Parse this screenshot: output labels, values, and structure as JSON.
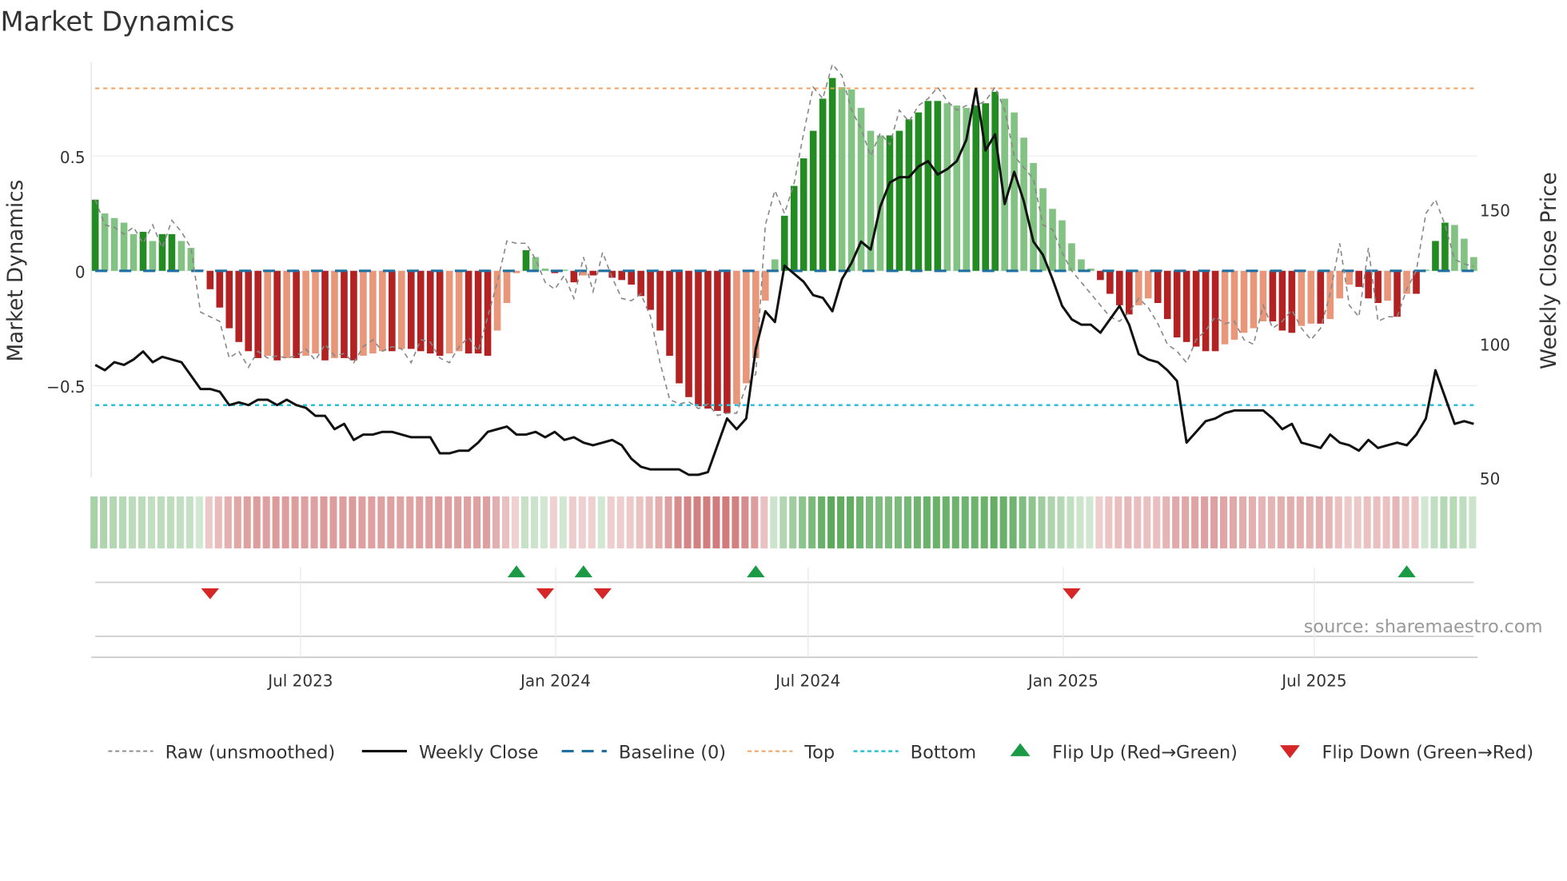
{
  "chart_data": {
    "type": "bar",
    "title": "Market Dynamics",
    "ylabel": "Market Dynamics",
    "ylabel_right": "Weekly Close Price",
    "ylim": [
      -0.9,
      0.91
    ],
    "ylim_right": [
      50,
      205
    ],
    "yticks": [
      {
        "value": 0.5,
        "label": "0.5"
      },
      {
        "value": 0,
        "label": "0"
      },
      {
        "value": -0.5,
        "label": "−0.5"
      }
    ],
    "yticks_right": [
      {
        "value": 150,
        "label": "150"
      },
      {
        "value": 100,
        "label": "100"
      },
      {
        "value": 50,
        "label": "50"
      }
    ],
    "x_start": "2023-02-03",
    "x_end": "2025-10-24",
    "xticks": [
      {
        "date": "2023-07-01",
        "label": "Jul 2023"
      },
      {
        "date": "2024-01-01",
        "label": "Jan 2024"
      },
      {
        "date": "2024-07-01",
        "label": "Jul 2024"
      },
      {
        "date": "2025-01-01",
        "label": "Jan 2025"
      },
      {
        "date": "2025-07-01",
        "label": "Jul 2025"
      }
    ],
    "top_level": 0.795,
    "bottom_level": -0.585,
    "baseline": 0,
    "bars": [
      0.31,
      0.25,
      0.23,
      0.21,
      0.16,
      0.17,
      0.13,
      0.16,
      0.16,
      0.13,
      0.1,
      0.005,
      -0.08,
      -0.16,
      -0.25,
      -0.31,
      -0.35,
      -0.38,
      -0.37,
      -0.39,
      -0.38,
      -0.38,
      -0.37,
      -0.36,
      -0.39,
      -0.38,
      -0.38,
      -0.39,
      -0.37,
      -0.36,
      -0.35,
      -0.35,
      -0.34,
      -0.34,
      -0.35,
      -0.36,
      -0.37,
      -0.36,
      -0.35,
      -0.36,
      -0.36,
      -0.37,
      -0.26,
      -0.14,
      -0.01,
      0.09,
      0.06,
      0.01,
      -0.01,
      0.005,
      -0.05,
      -0.02,
      -0.02,
      0.005,
      -0.03,
      -0.04,
      -0.06,
      -0.11,
      -0.17,
      -0.26,
      -0.37,
      -0.49,
      -0.55,
      -0.59,
      -0.6,
      -0.61,
      -0.62,
      -0.58,
      -0.49,
      -0.38,
      -0.13,
      0.05,
      0.24,
      0.37,
      0.49,
      0.61,
      0.75,
      0.84,
      0.8,
      0.79,
      0.71,
      0.61,
      0.59,
      0.59,
      0.61,
      0.66,
      0.69,
      0.74,
      0.74,
      0.73,
      0.72,
      0.71,
      0.72,
      0.73,
      0.78,
      0.75,
      0.69,
      0.58,
      0.47,
      0.36,
      0.27,
      0.22,
      0.12,
      0.05,
      0.01,
      -0.04,
      -0.1,
      -0.15,
      -0.19,
      -0.15,
      -0.12,
      -0.14,
      -0.21,
      -0.29,
      -0.31,
      -0.33,
      -0.35,
      -0.35,
      -0.32,
      -0.3,
      -0.27,
      -0.25,
      -0.22,
      -0.22,
      -0.26,
      -0.27,
      -0.24,
      -0.23,
      -0.23,
      -0.21,
      -0.12,
      -0.06,
      -0.07,
      -0.12,
      -0.14,
      -0.13,
      -0.2,
      -0.1,
      -0.1,
      0.005,
      0.13,
      0.21,
      0.2,
      0.14,
      0.06
    ],
    "raw": [
      0.31,
      0.2,
      0.19,
      0.16,
      0.19,
      0.12,
      0.2,
      0.1,
      0.22,
      0.17,
      0.1,
      -0.18,
      -0.2,
      -0.22,
      -0.38,
      -0.35,
      -0.42,
      -0.35,
      -0.38,
      -0.37,
      -0.38,
      -0.37,
      -0.34,
      -0.39,
      -0.32,
      -0.37,
      -0.36,
      -0.4,
      -0.33,
      -0.3,
      -0.35,
      -0.33,
      -0.34,
      -0.4,
      -0.3,
      -0.31,
      -0.38,
      -0.4,
      -0.33,
      -0.29,
      -0.35,
      -0.2,
      -0.05,
      0.13,
      0.12,
      0.12,
      0.05,
      -0.05,
      -0.08,
      -0.02,
      -0.12,
      0.06,
      -0.09,
      0.08,
      -0.03,
      -0.12,
      -0.13,
      -0.1,
      -0.2,
      -0.4,
      -0.56,
      -0.58,
      -0.57,
      -0.6,
      -0.58,
      -0.63,
      -0.62,
      -0.62,
      -0.5,
      -0.45,
      0.2,
      0.35,
      0.25,
      0.38,
      0.6,
      0.8,
      0.75,
      0.9,
      0.85,
      0.7,
      0.62,
      0.5,
      0.6,
      0.55,
      0.7,
      0.65,
      0.72,
      0.75,
      0.8,
      0.74,
      0.7,
      0.72,
      0.72,
      0.74,
      0.8,
      0.7,
      0.5,
      0.45,
      0.4,
      0.2,
      0.18,
      0.08,
      0.0,
      -0.05,
      -0.1,
      -0.15,
      -0.2,
      -0.22,
      -0.18,
      -0.12,
      -0.16,
      -0.23,
      -0.32,
      -0.35,
      -0.4,
      -0.3,
      -0.26,
      -0.2,
      -0.23,
      -0.22,
      -0.3,
      -0.32,
      -0.15,
      -0.25,
      -0.22,
      -0.17,
      -0.25,
      -0.3,
      -0.25,
      -0.1,
      0.12,
      -0.15,
      -0.2,
      0.1,
      -0.22,
      -0.2,
      -0.2,
      -0.08,
      0.0,
      0.25,
      0.31,
      0.2,
      0.05,
      0.03,
      0.02
    ],
    "close": [
      92,
      90,
      93,
      92,
      94,
      97,
      93,
      95,
      94,
      93,
      88,
      83,
      83,
      82,
      77,
      78,
      77,
      79,
      79,
      77,
      79,
      77,
      76,
      73,
      73,
      68,
      70,
      64,
      66,
      66,
      67,
      67,
      66,
      65,
      65,
      65,
      59,
      59,
      60,
      60,
      63,
      67,
      68,
      69,
      66,
      66,
      67,
      65,
      67,
      64,
      65,
      63,
      62,
      63,
      64,
      62,
      57,
      54,
      53,
      53,
      53,
      53,
      51,
      51,
      52,
      62,
      72,
      68,
      72,
      98,
      112,
      108,
      129,
      126,
      123,
      118,
      117,
      112,
      124,
      130,
      138,
      135,
      151,
      160,
      162,
      162,
      166,
      168,
      163,
      165,
      168,
      176,
      195,
      172,
      178,
      152,
      164,
      153,
      138,
      133,
      124,
      114,
      109,
      107,
      107,
      104,
      109,
      114,
      107,
      96,
      94,
      93,
      90,
      86,
      63,
      67,
      71,
      72,
      74,
      75,
      75,
      75,
      75,
      72,
      68,
      70,
      63,
      62,
      61,
      66,
      63,
      62,
      60,
      64,
      61,
      62,
      63,
      62,
      66,
      72,
      90,
      80,
      70,
      71,
      70
    ],
    "flip_up_weeks": [
      44,
      51,
      69,
      137
    ],
    "flip_down_weeks": [
      12,
      47,
      53,
      102
    ],
    "colors": {
      "green_strong": "#228b22",
      "green_weak": "#82c282",
      "red_strong": "#b22222",
      "red_weak": "#e8977a",
      "top": "#f0a060",
      "bottom": "#2bc0d8",
      "baseline": "#1f6fa0",
      "flip_up": "#1a9a45",
      "flip_down": "#d62728"
    },
    "legend": [
      {
        "label": "Raw (unsmoothed)"
      },
      {
        "label": "Weekly Close"
      },
      {
        "label": "Baseline (0)"
      },
      {
        "label": "Top"
      },
      {
        "label": "Bottom"
      },
      {
        "label": "Flip Up (Red→Green)"
      },
      {
        "label": "Flip Down (Green→Red)"
      }
    ],
    "source": "source: sharemaestro.com"
  }
}
